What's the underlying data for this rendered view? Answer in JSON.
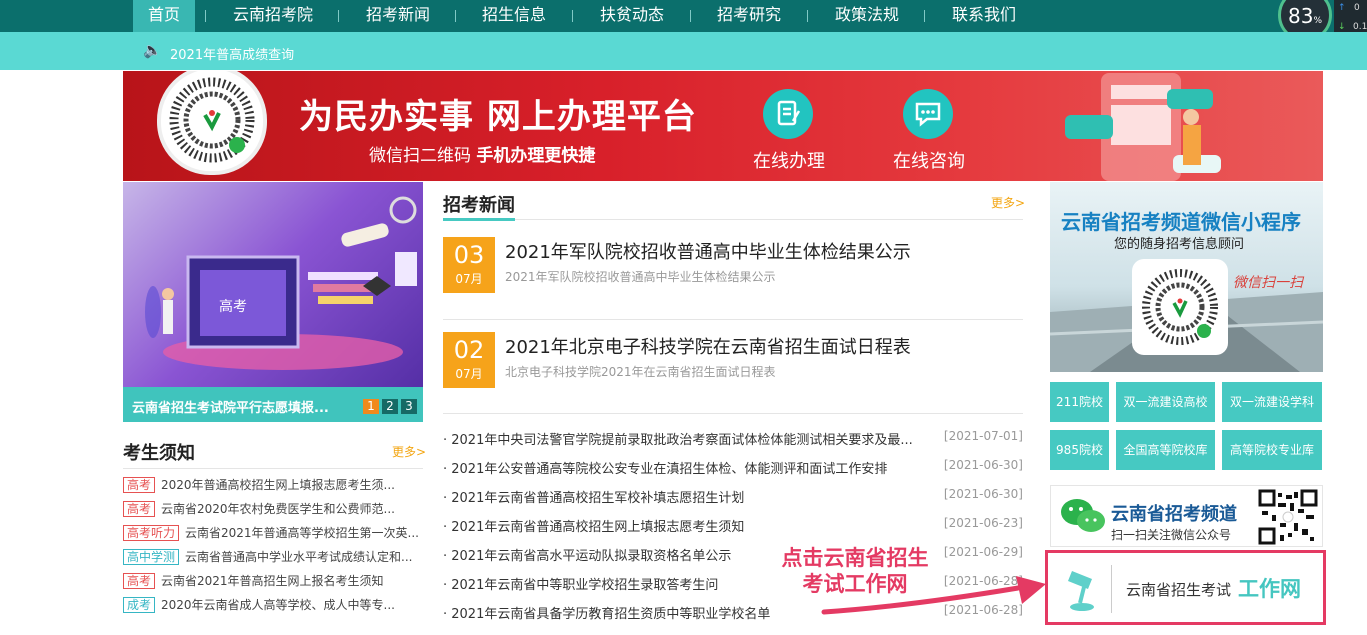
{
  "nav": {
    "items": [
      {
        "label": "首页",
        "active": true
      },
      {
        "label": "云南招考院"
      },
      {
        "label": "招考新闻"
      },
      {
        "label": "招生信息"
      },
      {
        "label": "扶贫动态"
      },
      {
        "label": "招考研究"
      },
      {
        "label": "政策法规"
      },
      {
        "label": "联系我们"
      }
    ],
    "speed_pct": "83",
    "speed_unit": "%",
    "side_up": "0",
    "side_down": "0.1"
  },
  "notice": {
    "icon": "speaker-icon",
    "text": "2021年普高成绩查询"
  },
  "banner": {
    "title": "为民办实事 网上办理平台",
    "sub_a": "微信扫二维码",
    "sub_b": "手机办理更快捷",
    "btn_online": "在线办理",
    "btn_consult": "在线咨询"
  },
  "slideshow": {
    "image_text": "高考",
    "caption": "云南省招生考试院平行志愿填报...",
    "pages": [
      "1",
      "2",
      "3"
    ],
    "active_page": 1
  },
  "notices": {
    "title": "考生须知",
    "more": "更多>",
    "items": [
      {
        "tag": "高考",
        "text": "2020年普通高校招生网上填报志愿考生须..."
      },
      {
        "tag": "高考",
        "text": "云南省2020年农村免费医学生和公费师范..."
      },
      {
        "tag": "高考听力",
        "text": "云南省2021年普通高等学校招生第一次英..."
      },
      {
        "tag": "高中学测",
        "text": "云南省普通高中学业水平考试成绩认定和..."
      },
      {
        "tag": "高考",
        "text": "云南省2021年普高招生网上报名考生须知"
      },
      {
        "tag": "成考",
        "text": "2020年云南省成人高等学校、成人中等专..."
      }
    ]
  },
  "news": {
    "title": "招考新闻",
    "more": "更多>",
    "featured": [
      {
        "day": "03",
        "month": "07月",
        "title": "2021年军队院校招收普通高中毕业生体检结果公示",
        "sub": "2021年军队院校招收普通高中毕业生体检结果公示"
      },
      {
        "day": "02",
        "month": "07月",
        "title": "2021年北京电子科技学院在云南省招生面试日程表",
        "sub": "北京电子科技学院2021年在云南省招生面试日程表"
      }
    ],
    "list": [
      {
        "title": "· 2021年中央司法警官学院提前录取批政治考察面试体检体能测试相关要求及最...",
        "date": "[2021-07-01]"
      },
      {
        "title": "· 2021年公安普通高等院校公安专业在滇招生体检、体能测评和面试工作安排",
        "date": "[2021-06-30]"
      },
      {
        "title": "· 2021年云南省普通高校招生军校补填志愿招生计划",
        "date": "[2021-06-30]"
      },
      {
        "title": "· 2021年云南省普通高校招生网上填报志愿考生须知",
        "date": "[2021-06-23]"
      },
      {
        "title": "· 2021年云南省高水平运动队拟录取资格名单公示",
        "date": "[2021-06-29]"
      },
      {
        "title": "· 2021年云南省中等职业学校招生录取答考生问",
        "date": "[2021-06-28]"
      },
      {
        "title": "· 2021年云南省具备学历教育招生资质中等职业学校名单",
        "date": "[2021-06-28]"
      }
    ]
  },
  "mini_program": {
    "title": "云南省招考频道微信小程序",
    "subtitle": "您的随身招考信息顾问",
    "handwrite": "微信扫一扫"
  },
  "quick_links": [
    "211院校",
    "双一流建设高校",
    "双一流建设学科",
    "985院校",
    "全国高等院校库",
    "高等院校专业库"
  ],
  "wechat": {
    "title": "云南省招考频道",
    "subtitle": "扫一扫关注微信公众号"
  },
  "workbox": {
    "text_a": "云南省招生考试",
    "text_b": "工作网"
  },
  "callout": {
    "line1": "点击云南省招生",
    "line2": "考试工作网"
  },
  "colors": {
    "nav": "#0b6f6c",
    "teal": "#46c9c2",
    "banner_red": "#d8202a",
    "accent_orange": "#f6a31a",
    "highlight_pink": "#e43a63"
  }
}
